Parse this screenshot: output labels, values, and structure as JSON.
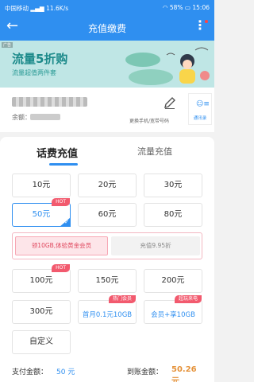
{
  "status_bar": {
    "carrier": "中国移动",
    "speed": "11.6K/s",
    "battery": "58%",
    "time": "15:06"
  },
  "header": {
    "title": "充值缴费"
  },
  "banner": {
    "ad_tag": "广告",
    "headline": "流量5折购",
    "subline": "流量超值两件套",
    "page_count": 5
  },
  "phone_card": {
    "balance_label": "余额：",
    "change_label": "更换手机/宽带号码",
    "contacts_label": "通讯录"
  },
  "tabs": {
    "active": "话费充值",
    "inactive": "流量充值"
  },
  "options": {
    "r1": [
      "10元",
      "20元",
      "30元"
    ],
    "r2": [
      "50元",
      "60元",
      "80元"
    ],
    "r3": [
      "100元",
      "150元",
      "200元"
    ],
    "r4_1": "300元",
    "r4_2_badge": "热门会员",
    "r4_2": "首月0.1元10GB",
    "r4_3_badge": "超玩来电",
    "r4_3": "会员+享10GB",
    "custom": "自定义",
    "hot1": "HOT",
    "hot2": "HOT"
  },
  "promo": {
    "left": "领10GB,体验黄金会员",
    "right": "充值9.95折"
  },
  "footer": {
    "pay_label": "支付金额：",
    "pay_value": "50 元",
    "receive_label": "到账金额：",
    "receive_value": "50.26元"
  },
  "colors": {
    "primary": "#2f8ff0",
    "banner_bg": "#bfe6e5",
    "hot_badge": "#f25a6e",
    "receive_amount": "#e5933c"
  }
}
